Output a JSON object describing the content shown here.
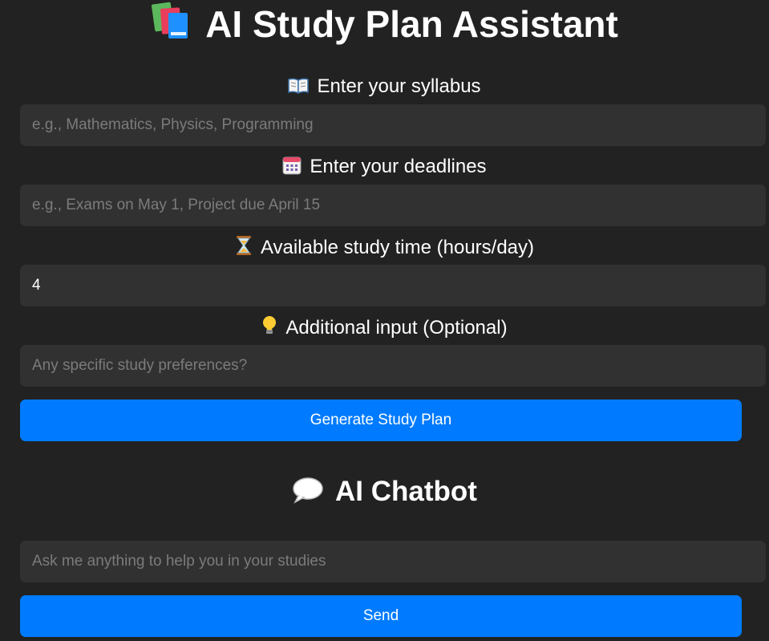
{
  "app": {
    "title": "AI Study Plan Assistant",
    "title_icon": "books-icon"
  },
  "form": {
    "syllabus": {
      "label": "Enter your syllabus",
      "icon": "open-book-icon",
      "placeholder": "e.g., Mathematics, Physics, Programming",
      "value": ""
    },
    "deadlines": {
      "label": "Enter your deadlines",
      "icon": "calendar-icon",
      "placeholder": "e.g., Exams on May 1, Project due April 15",
      "value": ""
    },
    "study_time": {
      "label": "Available study time (hours/day)",
      "icon": "hourglass-icon",
      "placeholder": "",
      "value": "4"
    },
    "additional": {
      "label": "Additional input (Optional)",
      "icon": "light-bulb-icon",
      "placeholder": "Any specific study preferences?",
      "value": ""
    },
    "generate_label": "Generate Study Plan"
  },
  "chatbot": {
    "title": "AI Chatbot",
    "icon": "speech-bubble-icon",
    "placeholder": "Ask me anything to help you in your studies",
    "value": "",
    "send_label": "Send"
  },
  "colors": {
    "background": "#222222",
    "input_background": "#313131",
    "accent": "#007bff",
    "placeholder": "#7b7b7b"
  }
}
